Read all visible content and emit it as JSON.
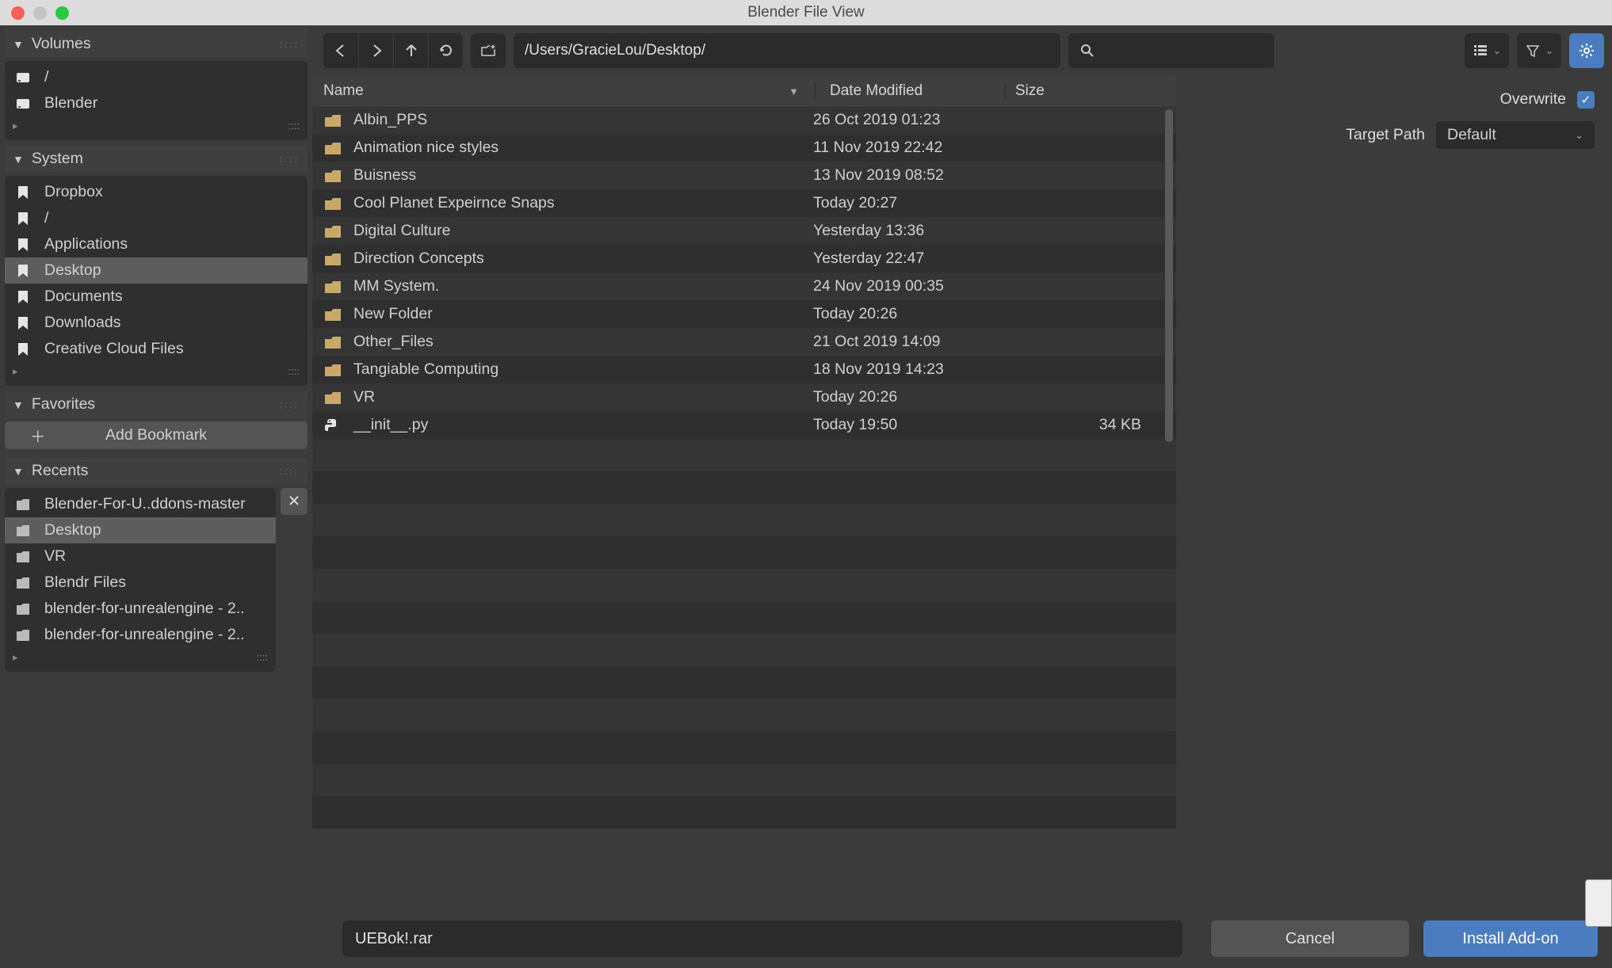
{
  "window": {
    "title": "Blender File View"
  },
  "sidebar": {
    "volumes": {
      "label": "Volumes",
      "items": [
        {
          "label": "/"
        },
        {
          "label": "Blender"
        }
      ]
    },
    "system": {
      "label": "System",
      "items": [
        {
          "label": "Dropbox"
        },
        {
          "label": "/"
        },
        {
          "label": "Applications"
        },
        {
          "label": "Desktop",
          "selected": true
        },
        {
          "label": "Documents"
        },
        {
          "label": "Downloads"
        },
        {
          "label": "Creative Cloud Files"
        }
      ]
    },
    "favorites": {
      "label": "Favorites",
      "add_label": "Add Bookmark"
    },
    "recents": {
      "label": "Recents",
      "items": [
        {
          "label": "Blender-For-U..ddons-master"
        },
        {
          "label": "Desktop",
          "selected": true
        },
        {
          "label": "VR"
        },
        {
          "label": "Blendr Files"
        },
        {
          "label": "blender-for-unrealengine - 2.."
        },
        {
          "label": "blender-for-unrealengine - 2.."
        }
      ]
    }
  },
  "toolbar": {
    "path": "/Users/GracieLou/Desktop/"
  },
  "columns": {
    "name": "Name",
    "date": "Date Modified",
    "size": "Size"
  },
  "files": [
    {
      "type": "folder",
      "name": "Albin_PPS",
      "date": "26 Oct 2019 01:23",
      "size": ""
    },
    {
      "type": "folder",
      "name": "Animation nice styles",
      "date": "11 Nov 2019 22:42",
      "size": ""
    },
    {
      "type": "folder",
      "name": "Buisness",
      "date": "13 Nov 2019 08:52",
      "size": ""
    },
    {
      "type": "folder",
      "name": "Cool Planet Expeirnce Snaps",
      "date": "Today 20:27",
      "size": ""
    },
    {
      "type": "folder",
      "name": "Digital Culture",
      "date": "Yesterday 13:36",
      "size": ""
    },
    {
      "type": "folder",
      "name": "Direction Concepts",
      "date": "Yesterday 22:47",
      "size": ""
    },
    {
      "type": "folder",
      "name": "MM System.",
      "date": "24 Nov 2019 00:35",
      "size": ""
    },
    {
      "type": "folder",
      "name": "New Folder",
      "date": "Today 20:26",
      "size": ""
    },
    {
      "type": "folder",
      "name": "Other_Files",
      "date": "21 Oct 2019 14:09",
      "size": ""
    },
    {
      "type": "folder",
      "name": "Tangiable Computing",
      "date": "18 Nov 2019 14:23",
      "size": ""
    },
    {
      "type": "folder",
      "name": "VR",
      "date": "Today 20:26",
      "size": ""
    },
    {
      "type": "py",
      "name": "__init__.py",
      "date": "Today 19:50",
      "size": "34 KB"
    }
  ],
  "props": {
    "overwrite_label": "Overwrite",
    "target_path_label": "Target Path",
    "target_path_value": "Default"
  },
  "bottom": {
    "filename": "UEBok!.rar",
    "cancel": "Cancel",
    "confirm": "Install Add-on"
  }
}
